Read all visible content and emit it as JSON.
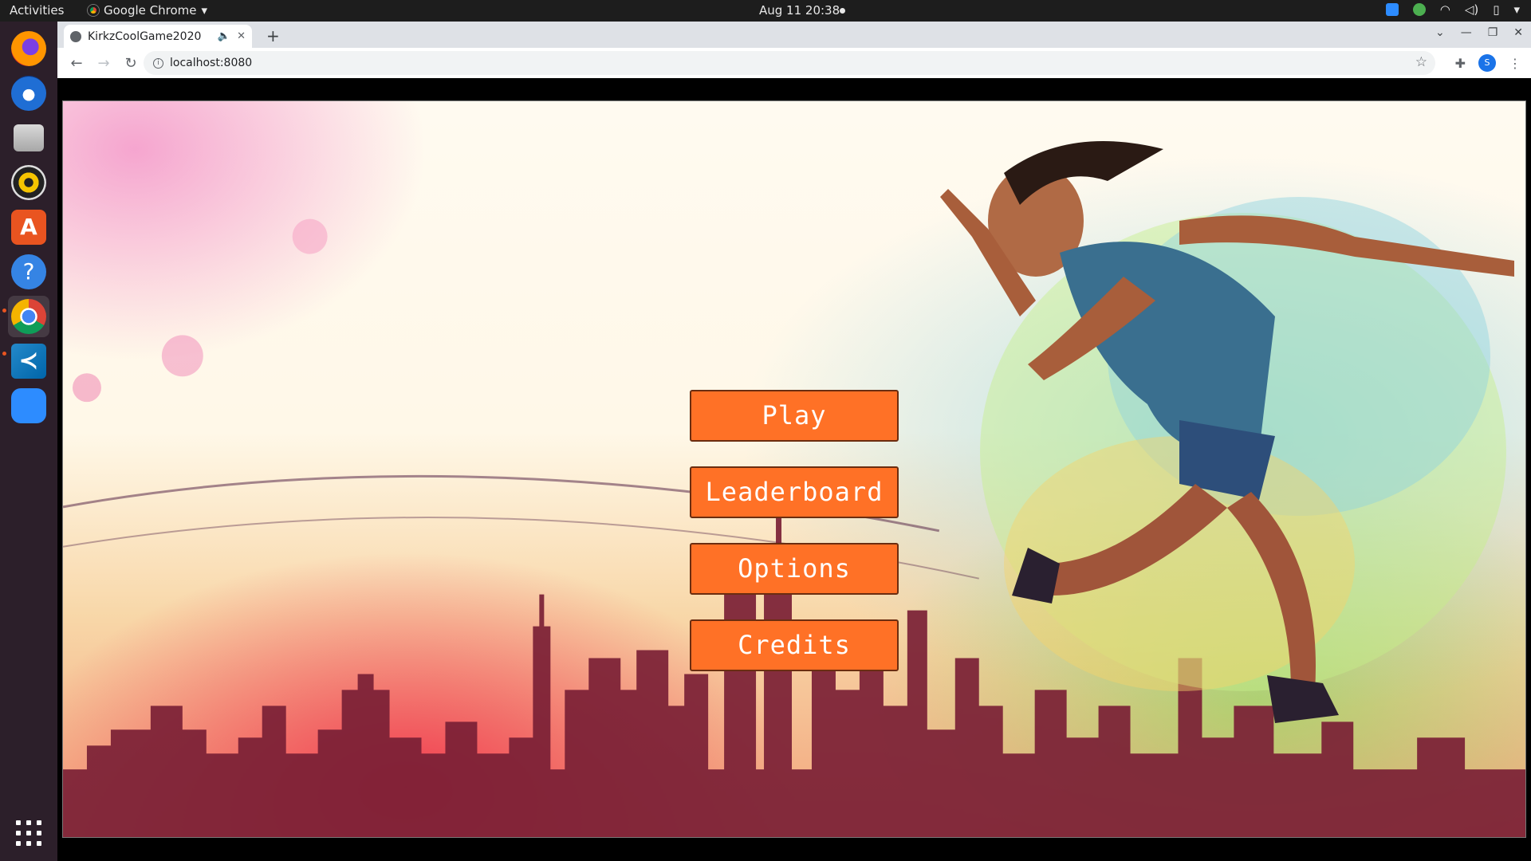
{
  "topbar": {
    "activities": "Activities",
    "app_name": "Google Chrome",
    "clock": "Aug 11  20:38"
  },
  "dock": {
    "apps": [
      "Firefox",
      "Thunderbird",
      "Files",
      "Rhythmbox",
      "Ubuntu Software",
      "Help",
      "Google Chrome",
      "Visual Studio Code",
      "Zoom"
    ]
  },
  "browser": {
    "tab_title": "KirkzCoolGame2020",
    "url": "localhost:8080",
    "profile_initial": "S"
  },
  "game": {
    "menu": {
      "play_label": "Play",
      "leaderboard_label": "Leaderboard",
      "options_label": "Options",
      "credits_label": "Credits"
    },
    "button_color": "#ff7126"
  }
}
